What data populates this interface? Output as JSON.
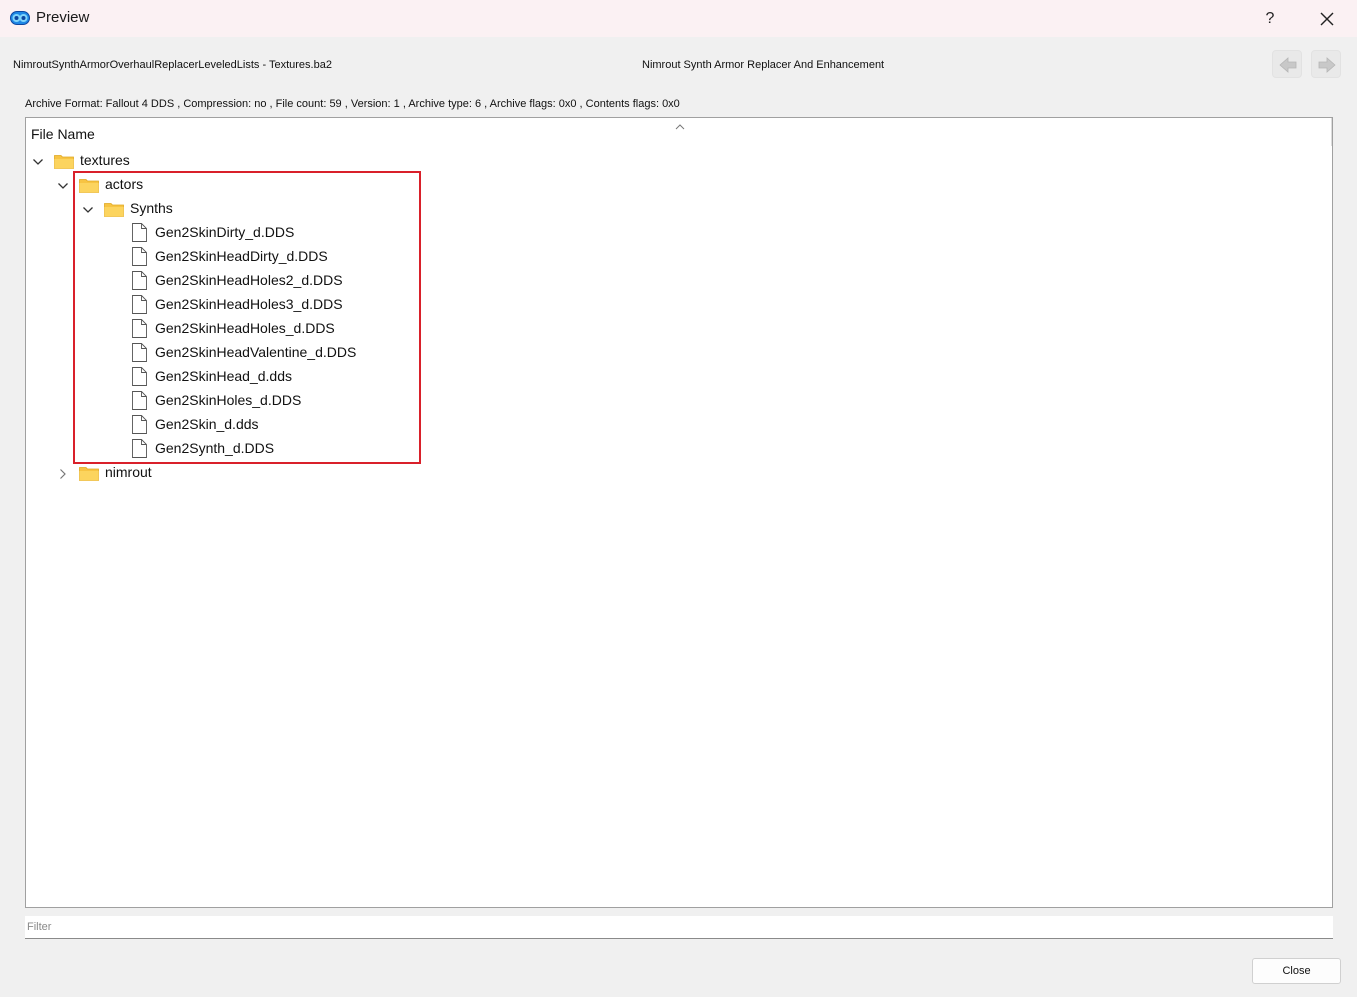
{
  "window": {
    "title": "Preview",
    "help_label": "?",
    "close_icon": "close-icon",
    "app_icon": "mod-organizer-icon"
  },
  "header": {
    "archive_name": "NimroutSynthArmorOverhaulReplacerLeveledLists - Textures.ba2",
    "mod_name": "Nimrout Synth Armor Replacer And Enhancement",
    "nav_prev_icon": "arrow-left-icon",
    "nav_next_icon": "arrow-right-icon"
  },
  "info": {
    "text": "Archive Format: Fallout 4 DDS , Compression: no , File count: 59 , Version: 1 , Archive type: 6 , Archive flags: 0x0 , Contents flags: 0x0"
  },
  "tree": {
    "column_header": "File Name",
    "rows": [
      {
        "label": "textures",
        "type": "folder",
        "depth": 0,
        "state": "expanded"
      },
      {
        "label": "actors",
        "type": "folder",
        "depth": 1,
        "state": "expanded"
      },
      {
        "label": "Synths",
        "type": "folder",
        "depth": 2,
        "state": "expanded"
      },
      {
        "label": "Gen2SkinDirty_d.DDS",
        "type": "file",
        "depth": 3,
        "state": "leaf"
      },
      {
        "label": "Gen2SkinHeadDirty_d.DDS",
        "type": "file",
        "depth": 3,
        "state": "leaf"
      },
      {
        "label": "Gen2SkinHeadHoles2_d.DDS",
        "type": "file",
        "depth": 3,
        "state": "leaf"
      },
      {
        "label": "Gen2SkinHeadHoles3_d.DDS",
        "type": "file",
        "depth": 3,
        "state": "leaf"
      },
      {
        "label": "Gen2SkinHeadHoles_d.DDS",
        "type": "file",
        "depth": 3,
        "state": "leaf"
      },
      {
        "label": "Gen2SkinHeadValentine_d.DDS",
        "type": "file",
        "depth": 3,
        "state": "leaf"
      },
      {
        "label": "Gen2SkinHead_d.dds",
        "type": "file",
        "depth": 3,
        "state": "leaf"
      },
      {
        "label": "Gen2SkinHoles_d.DDS",
        "type": "file",
        "depth": 3,
        "state": "leaf"
      },
      {
        "label": "Gen2Skin_d.dds",
        "type": "file",
        "depth": 3,
        "state": "leaf"
      },
      {
        "label": "Gen2Synth_d.DDS",
        "type": "file",
        "depth": 3,
        "state": "leaf"
      },
      {
        "label": "nimrout",
        "type": "folder",
        "depth": 1,
        "state": "collapsed"
      }
    ]
  },
  "filter": {
    "placeholder": "Filter",
    "value": ""
  },
  "footer": {
    "close_label": "Close"
  },
  "colors": {
    "highlight": "#d9202a",
    "folder": "#f7c443",
    "titlebar": "#fbf1f3"
  }
}
